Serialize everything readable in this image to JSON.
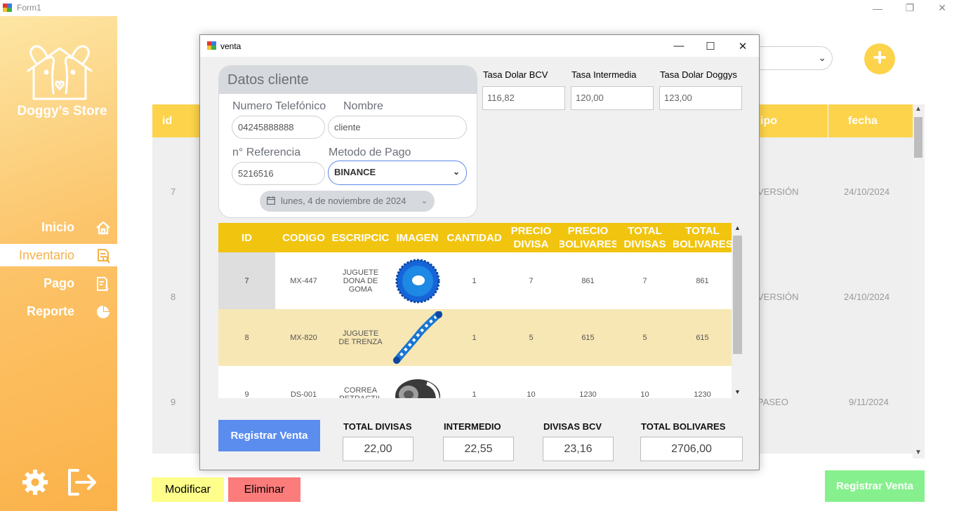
{
  "main_window": {
    "title": "Form1"
  },
  "sidebar": {
    "brand": "Doggy's Store",
    "nav": [
      {
        "label": "Inicio",
        "icon": "home-icon"
      },
      {
        "label": "Inventario",
        "icon": "inventory-icon"
      },
      {
        "label": "Pago",
        "icon": "payment-icon"
      },
      {
        "label": "Reporte",
        "icon": "report-icon"
      }
    ]
  },
  "background": {
    "table": {
      "headers": {
        "id": "id",
        "tipo": "ipo",
        "fecha": "fecha"
      },
      "rows": [
        {
          "id": "7",
          "tipo": "VERSIÓN",
          "fecha": "24/10/2024"
        },
        {
          "id": "8",
          "tipo": "VERSIÓN",
          "fecha": "24/10/2024"
        },
        {
          "id": "9",
          "tipo": "PASEO",
          "fecha": "9/11/2024"
        }
      ]
    },
    "buttons": {
      "modificar": "Modificar",
      "eliminar": "Eliminar",
      "registrar": "Registrar Venta"
    },
    "add_label": "+"
  },
  "venta": {
    "title": "venta",
    "datos_cliente": {
      "heading": "Datos cliente",
      "telefono_label": "Numero Telefónico",
      "telefono_value": "04245888888",
      "nombre_label": "Nombre",
      "nombre_value": "cliente",
      "referencia_label": "n° Referencia",
      "referencia_value": "5216516",
      "metodo_label": "Metodo de Pago",
      "metodo_value": "BINANCE",
      "fecha": "lunes, 4 de noviembre de 2024"
    },
    "tasas": [
      {
        "label": "Tasa Dolar BCV",
        "value": "116,82"
      },
      {
        "label": "Tasa Intermedia",
        "value": "120,00"
      },
      {
        "label": "Tasa Dolar Doggys",
        "value": "123,00"
      }
    ],
    "grid": {
      "headers": [
        "ID",
        "CODIGO",
        "ESCRIPCIC",
        "IMAGEN",
        "CANTIDAD",
        "PRECIO\nDIVISA",
        "PRECIO\nBOLIVARES",
        "TOTAL\nDIVISAS",
        "TOTAL\nBOLIVARES"
      ],
      "rows": [
        {
          "id": "7",
          "codigo": "MX-447",
          "descripcion": "JUGUETE DONA DE GOMA",
          "imagen": "blue-donut-toy",
          "cantidad": "1",
          "precio_divisa": "7",
          "precio_bolivares": "861",
          "total_divisas": "7",
          "total_bolivares": "861"
        },
        {
          "id": "8",
          "codigo": "MX-820",
          "descripcion": "JUGUETE DE TRENZA",
          "imagen": "rope-toy",
          "cantidad": "1",
          "precio_divisa": "5",
          "precio_bolivares": "615",
          "total_divisas": "5",
          "total_bolivares": "615"
        },
        {
          "id": "9",
          "codigo": "DS-001",
          "descripcion": "CORREA RETRACTIL",
          "imagen": "retractable-leash",
          "cantidad": "1",
          "precio_divisa": "10",
          "precio_bolivares": "1230",
          "total_divisas": "10",
          "total_bolivares": "1230"
        }
      ]
    },
    "registrar_label": "Registrar Venta",
    "totales": [
      {
        "label": "TOTAL DIVISAS",
        "value": "22,00"
      },
      {
        "label": "INTERMEDIO",
        "value": "22,55"
      },
      {
        "label": "DIVISAS BCV",
        "value": "23,16"
      },
      {
        "label": "TOTAL BOLIVARES",
        "value": "2706,00"
      }
    ]
  },
  "colors": {
    "accent_yellow": "#f1c40f",
    "sidebar_orange": "#fbb24a",
    "button_blue": "#5b8def",
    "highlight_row": "#f7e7b4",
    "modificar": "#fefe8a",
    "eliminar": "#fc7b7b",
    "registrar_bg": "#87f08e"
  }
}
